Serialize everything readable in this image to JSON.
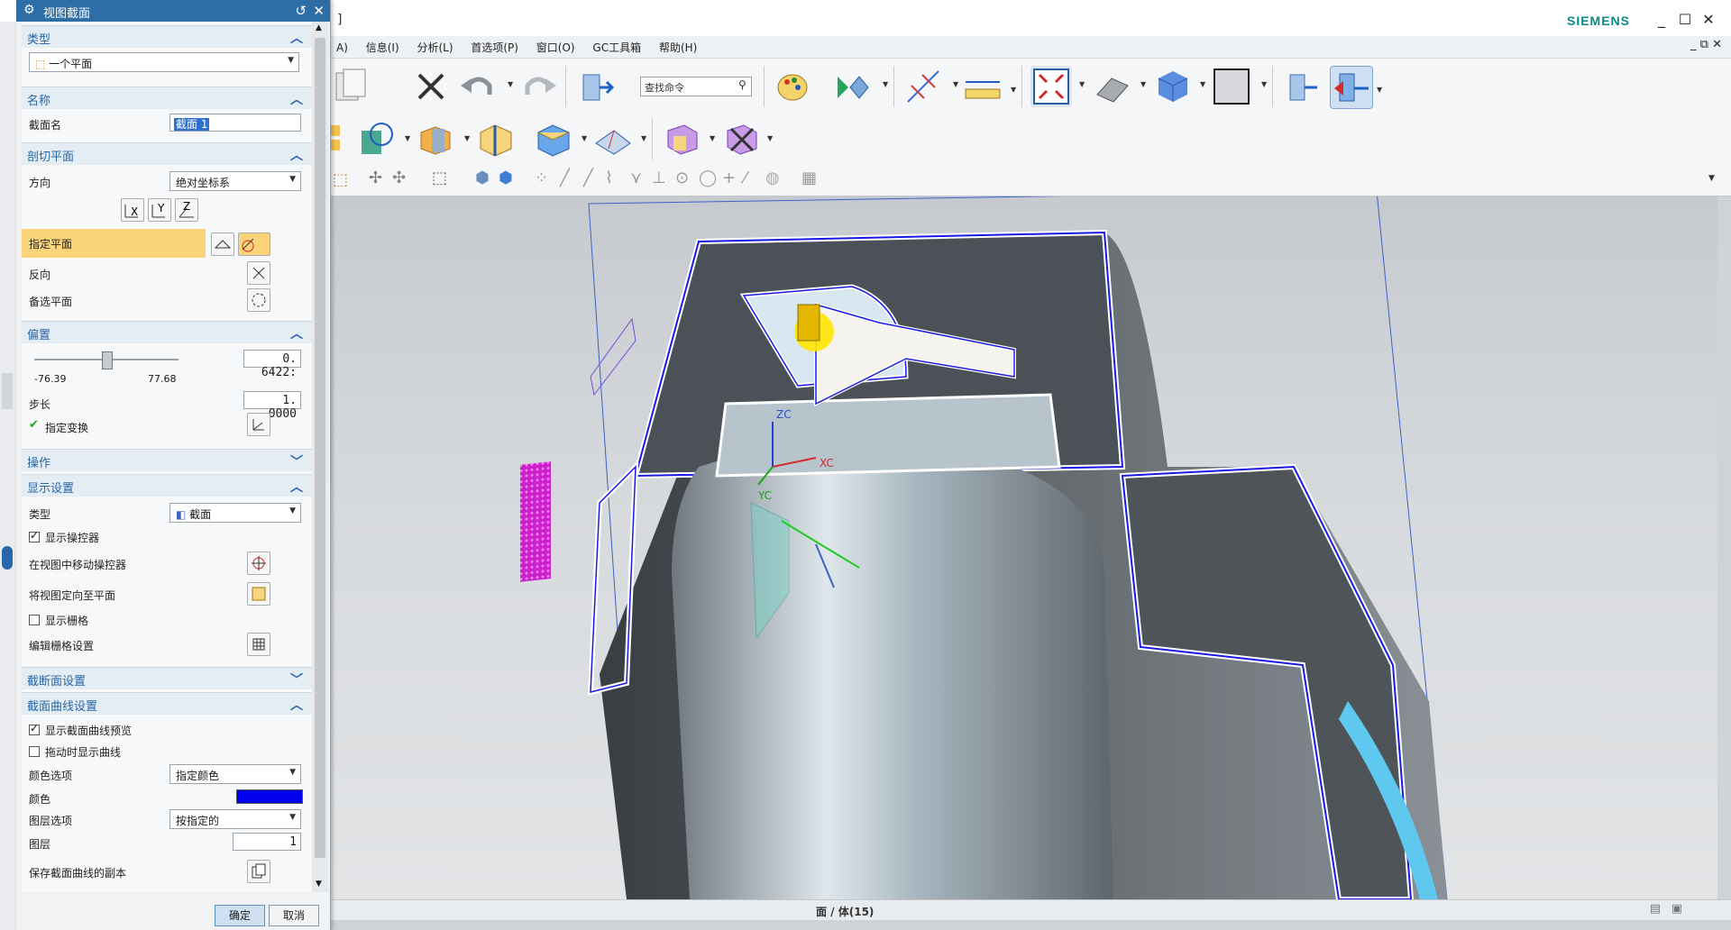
{
  "window": {
    "title_fragment": "]",
    "brand": "SIEMENS",
    "min": "_",
    "max": "☐",
    "close": "✕",
    "doc_ctrls": "_  ⧉  ✕"
  },
  "menu": {
    "items": [
      "A)",
      "信息(I)",
      "分析(L)",
      "首选项(P)",
      "窗口(O)",
      "GC工具箱",
      "帮助(H)"
    ]
  },
  "toolbar": {
    "search_label": "查找命令"
  },
  "status": {
    "selection": "面 / 体(15)"
  },
  "viewport": {
    "axis_x": "XC",
    "axis_y": "YC",
    "axis_z": "ZC",
    "colors": {
      "section_curve": "#0000ff",
      "highlight": "#ffe600",
      "magenta_grid": "#cc22cc"
    }
  },
  "dialog": {
    "title": "视图截面",
    "reset_icon": "↺",
    "close_icon": "✕",
    "sections": {
      "type": {
        "label": "类型",
        "value": "一个平面"
      },
      "name": {
        "label": "名称",
        "field_label": "截面名",
        "value": "截面 1"
      },
      "cutting_plane": {
        "label": "剖切平面",
        "direction_label": "方向",
        "direction_value": "绝对坐标系",
        "specify_plane": "指定平面",
        "reverse": "反向",
        "alternate": "备选平面"
      },
      "offset": {
        "label": "偏置",
        "value": "0. 6422:",
        "slider_fraction": 0.5,
        "min": "-76.39",
        "max": "77.68",
        "step_label": "步长",
        "step_value": "1. 0000",
        "transform_label": "指定变换"
      },
      "operation": {
        "label": "操作"
      },
      "display": {
        "label": "显示设置",
        "type_label": "类型",
        "type_value": "截面",
        "show_manip": "显示操控器",
        "move_manip": "在视图中移动操控器",
        "orient_view": "将视图定向至平面",
        "show_grid": "显示栅格",
        "edit_grid": "编辑栅格设置"
      },
      "section_face": {
        "label": "截断面设置"
      },
      "section_curve": {
        "label": "截面曲线设置",
        "show_preview": "显示截面曲线预览",
        "show_drag": "拖动时显示曲线",
        "color_opt_label": "颜色选项",
        "color_opt_value": "指定颜色",
        "color_label": "颜色",
        "color_value": "#0000ee",
        "layer_opt_label": "图层选项",
        "layer_opt_value": "按指定的",
        "layer_label": "图层",
        "layer_value": "1",
        "save_copy": "保存截面曲线的副本"
      }
    },
    "ok": "确定",
    "cancel": "取消"
  }
}
